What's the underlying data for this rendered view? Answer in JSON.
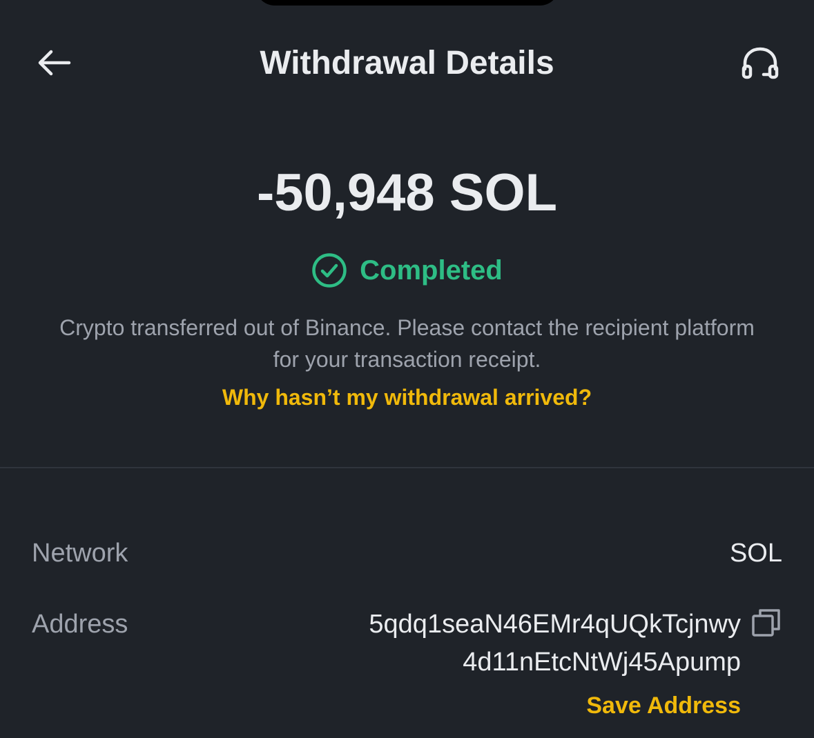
{
  "header": {
    "title": "Withdrawal Details",
    "back_icon": "arrow-left-icon",
    "support_icon": "headset-icon"
  },
  "summary": {
    "amount": "-50,948 SOL",
    "status": "Completed",
    "status_icon": "check-circle-icon",
    "status_color": "#2ebd85",
    "description": "Crypto transferred out of Binance. Please contact the recipient platform for your transaction receipt.",
    "help_link": "Why hasn’t my withdrawal arrived?"
  },
  "details": {
    "network": {
      "label": "Network",
      "value": "SOL"
    },
    "address": {
      "label": "Address",
      "line1": "5qdq1seaN46EMr4qUQkTcjnwy",
      "line2": "4d11nEtcNtWj45Apump",
      "copy_icon": "copy-icon",
      "save_label": "Save Address"
    }
  },
  "colors": {
    "background": "#1f2329",
    "accent": "#f0b90b",
    "success": "#2ebd85",
    "text_primary": "#eaecef",
    "text_secondary": "#9ea3ad"
  }
}
